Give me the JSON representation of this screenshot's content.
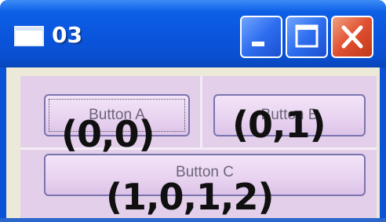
{
  "window": {
    "title": "03",
    "controls": [
      "minimize",
      "maximize",
      "close"
    ]
  },
  "buttons": {
    "a": {
      "label": "Button A",
      "cell": "(0,0)"
    },
    "b": {
      "label": "Button B",
      "cell": "(0,1)"
    },
    "c": {
      "label": "Button C",
      "cell": "(1,0,1,2)"
    }
  },
  "colors": {
    "titlebar": "#0a55dc",
    "client": "#ece9d8",
    "grid": "#e3cfe9",
    "button_border": "#7a74b0",
    "close": "#e05030"
  }
}
